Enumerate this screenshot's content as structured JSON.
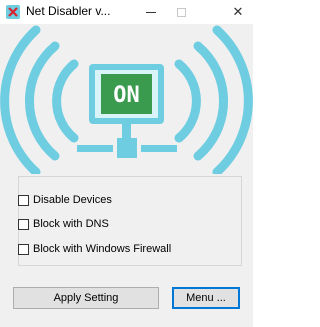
{
  "window": {
    "title": "Net Disabler v...",
    "controls": {
      "minimize": "minimize",
      "maximize": "maximize",
      "close": "✕"
    }
  },
  "status_graphic": {
    "label": "ON",
    "colors": {
      "signal": "#6ecde0",
      "panel": "#3a9a4e",
      "panel_bg": "#d8f4f8"
    }
  },
  "options": [
    {
      "label": "Disable Devices",
      "checked": false
    },
    {
      "label": "Block with DNS",
      "checked": false
    },
    {
      "label": "Block with Windows Firewall",
      "checked": false
    }
  ],
  "buttons": {
    "apply": "Apply Setting",
    "menu": "Menu ..."
  }
}
